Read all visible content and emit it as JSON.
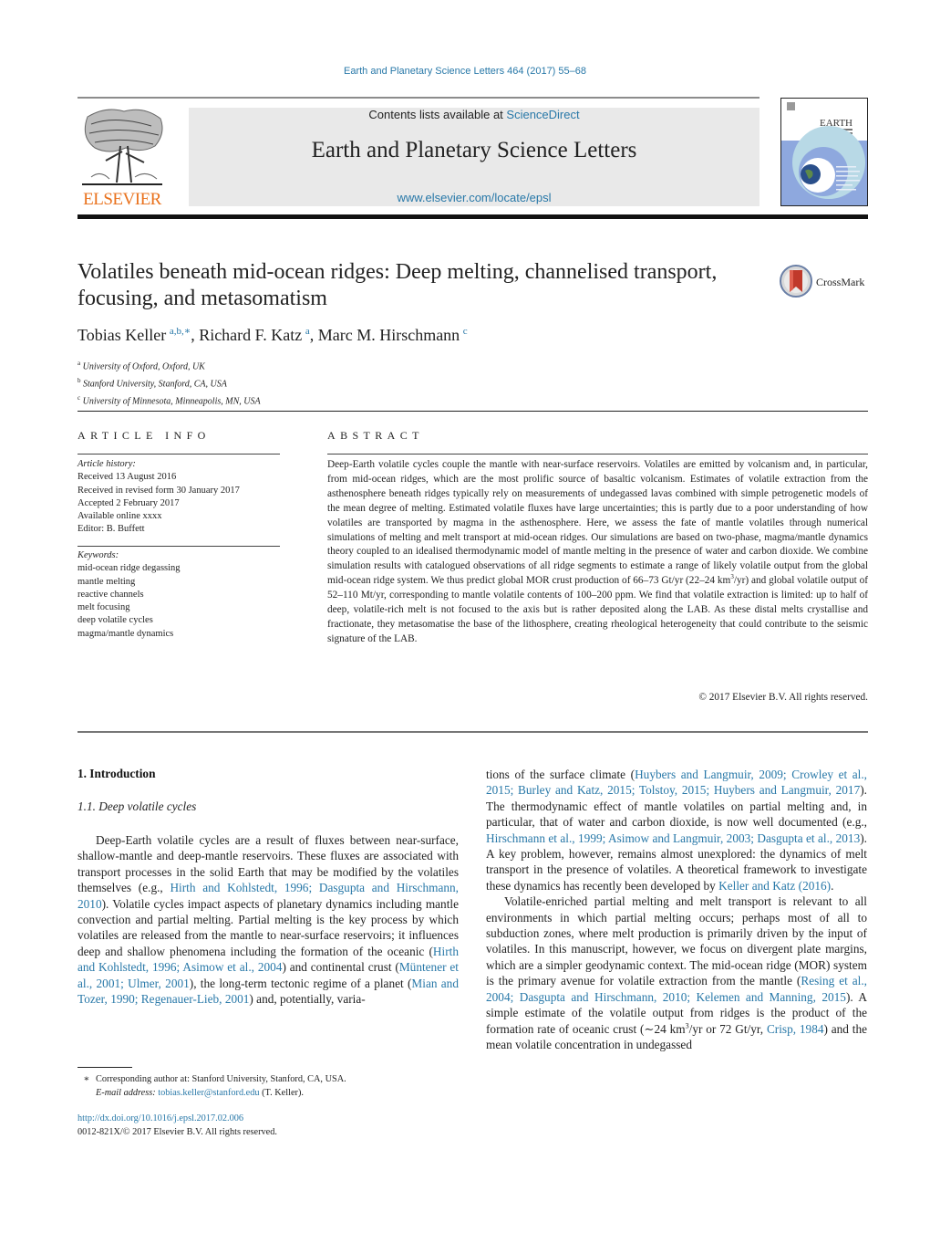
{
  "header": {
    "citation": "Earth and Planetary Science Letters 464 (2017) 55–68",
    "contents_prefix": "Contents lists available at ",
    "contents_link": "ScienceDirect",
    "journal_title": "Earth and Planetary Science Letters",
    "journal_url": "www.elsevier.com/locate/epsl",
    "publisher_logo_text": "ELSEVIER",
    "cover_title": "EARTH",
    "cover_subtitle": "AND PLANETARY SCIENCE LETTERS"
  },
  "article": {
    "title": "Volatiles beneath mid-ocean ridges: Deep melting, channelised transport, focusing, and metasomatism",
    "crossmark_label": "CrossMark",
    "authors": [
      {
        "name": "Tobias Keller",
        "sup": "a,b,∗"
      },
      {
        "name": "Richard F. Katz",
        "sup": "a"
      },
      {
        "name": "Marc M. Hirschmann",
        "sup": "c"
      }
    ],
    "affiliations": [
      {
        "key": "a",
        "text": "University of Oxford, Oxford, UK"
      },
      {
        "key": "b",
        "text": "Stanford University, Stanford, CA, USA"
      },
      {
        "key": "c",
        "text": "University of Minnesota, Minneapolis, MN, USA"
      }
    ]
  },
  "article_info": {
    "heading": "ARTICLE INFO",
    "history_label": "Article history:",
    "history": [
      "Received 13 August 2016",
      "Received in revised form 30 January 2017",
      "Accepted 2 February 2017",
      "Available online xxxx",
      "Editor: B. Buffett"
    ],
    "keywords_label": "Keywords:",
    "keywords": [
      "mid-ocean ridge degassing",
      "mantle melting",
      "reactive channels",
      "melt focusing",
      "deep volatile cycles",
      "magma/mantle dynamics"
    ]
  },
  "abstract": {
    "heading": "ABSTRACT",
    "text_part1": "Deep-Earth volatile cycles couple the mantle with near-surface reservoirs. Volatiles are emitted by volcanism and, in particular, from mid-ocean ridges, which are the most prolific source of basaltic volcanism. Estimates of volatile extraction from the asthenosphere beneath ridges typically rely on measurements of undegassed lavas combined with simple petrogenetic models of the mean degree of melting. Estimated volatile fluxes have large uncertainties; this is partly due to a poor understanding of how volatiles are transported by magma in the asthenosphere. Here, we assess the fate of mantle volatiles through numerical simulations of melting and melt transport at mid-ocean ridges. Our simulations are based on two-phase, magma/mantle dynamics theory coupled to an idealised thermodynamic model of mantle melting in the presence of water and carbon dioxide. We combine simulation results with catalogued observations of all ridge segments to estimate a range of likely volatile output from the global mid-ocean ridge system. We thus predict global MOR crust production of 66–73 Gt/yr (22–24 km",
    "text_sup": "3",
    "text_part2": "/yr) and global volatile output of 52–110 Mt/yr, corresponding to mantle volatile contents of 100–200 ppm. We find that volatile extraction is limited: up to half of deep, volatile-rich melt is not focused to the axis but is rather deposited along the LAB. As these distal melts crystallise and fractionate, they metasomatise the base of the lithosphere, creating rheological heterogeneity that could contribute to the seismic signature of the LAB.",
    "copyright": "© 2017 Elsevier B.V. All rights reserved."
  },
  "body": {
    "section_heading": "1. Introduction",
    "subsection_heading": "1.1. Deep volatile cycles",
    "left_column": [
      {
        "t": "Deep-Earth volatile cycles are a result of fluxes between near-surface, shallow-mantle and deep-mantle reservoirs. These fluxes are associated with transport processes in the solid Earth that may be modified by the volatiles themselves (e.g., "
      },
      {
        "t": "Hirth and Kohlstedt, 1996; Dasgupta and Hirschmann, 2010",
        "link": true
      },
      {
        "t": "). Volatile cycles impact aspects of planetary dynamics including mantle convection and partial melting. Partial melting is the key process by which volatiles are released from the mantle to near-surface reservoirs; it influences deep and shallow phenomena including the formation of the oceanic ("
      },
      {
        "t": "Hirth and Kohlstedt, 1996; Asimow et al., 2004",
        "link": true
      },
      {
        "t": ") and continental crust ("
      },
      {
        "t": "Müntener et al., 2001; Ulmer, 2001",
        "link": true
      },
      {
        "t": "), the long-term tectonic regime of a planet ("
      },
      {
        "t": "Mian and Tozer, 1990; Regenauer-Lieb, 2001",
        "link": true
      },
      {
        "t": ") and, potentially, varia-"
      }
    ],
    "right_para1": [
      {
        "t": "tions of the surface climate ("
      },
      {
        "t": "Huybers and Langmuir, 2009; Crowley et al., 2015; Burley and Katz, 2015; Tolstoy, 2015; Huybers and Langmuir, 2017",
        "link": true
      },
      {
        "t": "). The thermodynamic effect of mantle volatiles on partial melting and, in particular, that of water and carbon dioxide, is now well documented (e.g., "
      },
      {
        "t": "Hirschmann et al., 1999; Asimow and Langmuir, 2003; Dasgupta et al., 2013",
        "link": true
      },
      {
        "t": "). A key problem, however, remains almost unexplored: the dynamics of melt transport in the presence of volatiles. A theoretical framework to investigate these dynamics has recently been developed by "
      },
      {
        "t": "Keller and Katz (2016)",
        "link": true
      },
      {
        "t": "."
      }
    ],
    "right_para2": [
      {
        "t": "Volatile-enriched partial melting and melt transport is relevant to all environments in which partial melting occurs; perhaps most of all to subduction zones, where melt production is primarily driven by the input of volatiles. In this manuscript, however, we focus on divergent plate margins, which are a simpler geodynamic context. The mid-ocean ridge (MOR) system is the primary avenue for volatile extraction from the mantle ("
      },
      {
        "t": "Resing et al., 2004; Dasgupta and Hirschmann, 2010; Kelemen and Manning, 2015",
        "link": true
      },
      {
        "t": "). A simple estimate of the volatile output from ridges is the product of the formation rate of oceanic crust (∼24 km"
      },
      {
        "t": "3",
        "sup": true
      },
      {
        "t": "/yr or 72 Gt/yr, "
      },
      {
        "t": "Crisp, 1984",
        "link": true
      },
      {
        "t": ") and the mean volatile concentration in undegassed"
      }
    ]
  },
  "footnotes": {
    "star": "∗",
    "corresponding": "Corresponding author at: Stanford University, Stanford, CA, USA.",
    "email_label": "E-mail address: ",
    "email": "tobias.keller@stanford.edu",
    "email_suffix": " (T. Keller).",
    "doi": "http://dx.doi.org/10.1016/j.epsl.2017.02.006",
    "issn_rights": "0012-821X/© 2017 Elsevier B.V. All rights reserved."
  },
  "colors": {
    "link": "#2878a8",
    "elsevier_orange": "#e9711c",
    "masthead_bg": "#e9e9e9"
  }
}
